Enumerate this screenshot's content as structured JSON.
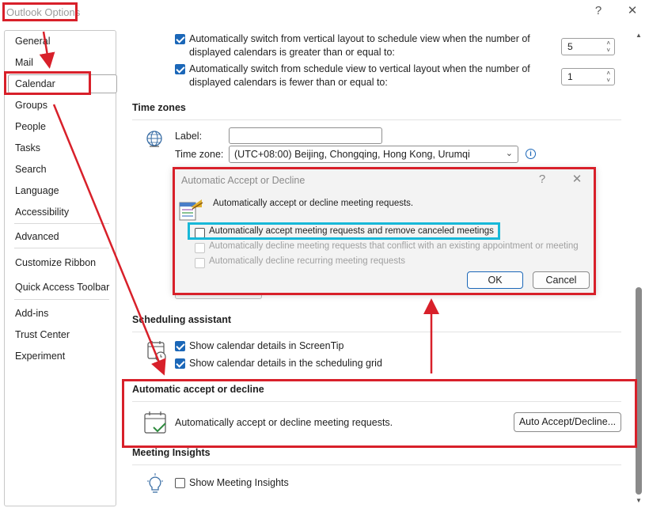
{
  "window": {
    "title": "Outlook Options",
    "help_glyph": "?",
    "close_glyph": "✕"
  },
  "nav": {
    "items": [
      {
        "label": "General"
      },
      {
        "label": "Mail"
      },
      {
        "label": "Calendar",
        "selected": true
      },
      {
        "label": "Groups"
      },
      {
        "label": "People"
      },
      {
        "label": "Tasks"
      },
      {
        "label": "Search"
      },
      {
        "label": "Language"
      },
      {
        "label": "Accessibility"
      },
      {
        "label": "Advanced"
      },
      {
        "label": "Customize Ribbon"
      },
      {
        "label": "Quick Access Toolbar"
      },
      {
        "label": "Add-ins"
      },
      {
        "label": "Trust Center"
      },
      {
        "label": "Experiment"
      }
    ]
  },
  "calendar_options": {
    "switch_to_schedule": {
      "checked": true,
      "line1": "Automatically switch from vertical layout to schedule view when the number of",
      "line2": "displayed calendars is greater than or equal to:",
      "value": "5"
    },
    "switch_to_vertical": {
      "checked": true,
      "line1": "Automatically switch from schedule view to vertical layout when the number of",
      "line2": "displayed calendars is fewer than or equal to:",
      "value": "1"
    }
  },
  "time_zones": {
    "heading": "Time zones",
    "label_caption": "Label:",
    "label_value": "",
    "timezone_caption": "Time zone:",
    "timezone_value": "(UTC+08:00) Beijing, Chongqing, Hong Kong, Urumqi",
    "info_glyph": "i"
  },
  "scheduling_assistant": {
    "heading": "Scheduling assistant",
    "show_screentip": {
      "checked": true,
      "label": "Show calendar details in ScreenTip"
    },
    "show_grid": {
      "checked": true,
      "label": "Show calendar details in the scheduling grid"
    }
  },
  "auto_accept_section": {
    "heading": "Automatic accept or decline",
    "description": "Automatically accept or decline meeting requests.",
    "button": "Auto Accept/Decline..."
  },
  "meeting_insights": {
    "heading": "Meeting Insights",
    "show": {
      "checked": false,
      "label": "Show Meeting Insights"
    }
  },
  "dialog": {
    "title": "Automatic Accept or Decline",
    "help_glyph": "?",
    "close_glyph": "✕",
    "intro": "Automatically accept or decline meeting requests.",
    "options": [
      {
        "label": "Automatically accept meeting requests and remove canceled meetings",
        "checked": false,
        "enabled": true
      },
      {
        "label": "Automatically decline meeting requests that conflict with an existing appointment or meeting",
        "checked": false,
        "enabled": false
      },
      {
        "label": "Automatically decline recurring meeting requests",
        "checked": false,
        "enabled": false
      }
    ],
    "ok": "OK",
    "cancel": "Cancel"
  },
  "colors": {
    "accent": "#1b67b8",
    "annotation_red": "#d8202a",
    "annotation_cyan": "#18b8d8"
  }
}
